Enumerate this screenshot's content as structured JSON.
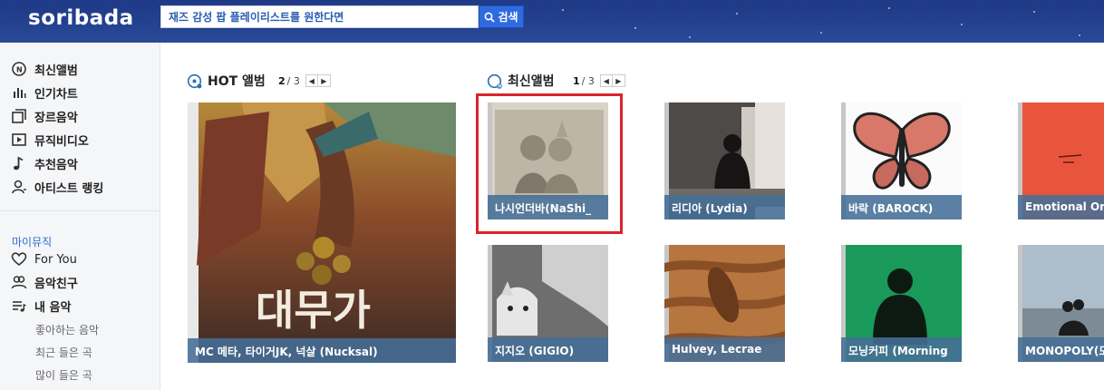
{
  "header": {
    "logo": "soribada",
    "search_value": "재즈 감성 팝 플레이리스트를 원한다면",
    "search_button": "검색"
  },
  "sidebar": {
    "items": [
      {
        "label": "최신앨범",
        "icon": "new-album-icon"
      },
      {
        "label": "인기차트",
        "icon": "chart-bars-icon"
      },
      {
        "label": "장르음악",
        "icon": "genre-icon"
      },
      {
        "label": "뮤직비디오",
        "icon": "video-icon"
      },
      {
        "label": "추천음악",
        "icon": "music-note-icon"
      },
      {
        "label": "아티스트 랭킹",
        "icon": "artist-icon"
      }
    ],
    "section_label": "마이뮤직",
    "my_items": [
      {
        "label": "For You",
        "icon": "heart-icon"
      },
      {
        "label": "음악친구",
        "icon": "friends-icon"
      },
      {
        "label": "내 음악",
        "icon": "playlist-icon"
      }
    ],
    "sub_items": [
      "좋아하는 음악",
      "최근 들은 곡",
      "많이 들은 곡"
    ]
  },
  "hot": {
    "title": "HOT 앨범",
    "page_current": "2",
    "page_total": "/ 3",
    "album": {
      "caption": "MC 메타, 타이거JK, 넉살 (Nucksal)",
      "title_text": "대무가"
    }
  },
  "latest": {
    "title": "최신앨범",
    "page_current": "1",
    "page_total": "/ 3",
    "albums": [
      {
        "caption": "나시언더바(NaShi_"
      },
      {
        "caption": "리디아 (Lydia)"
      },
      {
        "caption": "바락 (BAROCK)"
      },
      {
        "caption": "Emotional Ora"
      },
      {
        "caption": "지지오 (GIGIO)"
      },
      {
        "caption": "Hulvey, Lecrae"
      },
      {
        "caption": "모닝커피 (Morning"
      },
      {
        "caption": "MONOPOLY(모"
      }
    ]
  },
  "colors": {
    "header": "#23418f",
    "accent": "#2f6be0",
    "highlight": "#d9242b",
    "caption_bg": "#466e96"
  }
}
